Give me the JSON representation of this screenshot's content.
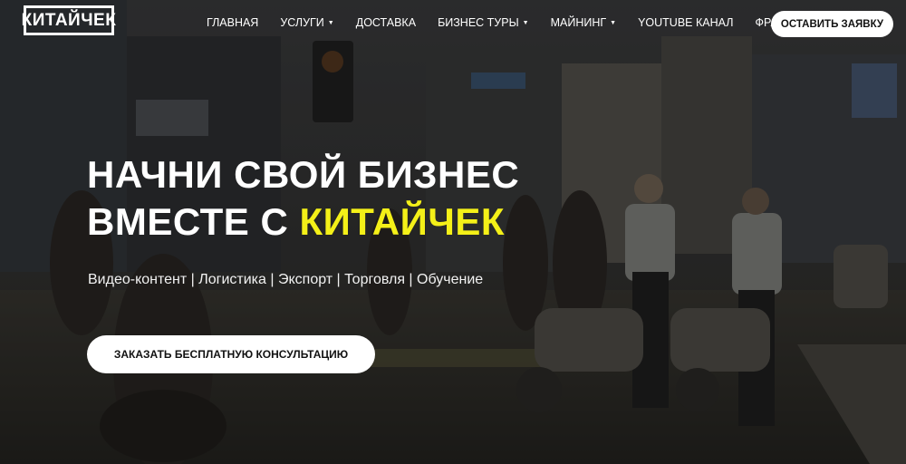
{
  "brand": {
    "logo_text": "КИТАЙЧЕК"
  },
  "nav": {
    "items": [
      {
        "label": "Главная",
        "dropdown": false
      },
      {
        "label": "Услуги",
        "dropdown": true
      },
      {
        "label": "Доставка",
        "dropdown": false
      },
      {
        "label": "Бизнес туры",
        "dropdown": true
      },
      {
        "label": "Майнинг",
        "dropdown": true
      },
      {
        "label": "YouTube канал",
        "dropdown": false
      },
      {
        "label": "Франшизы",
        "dropdown": false
      }
    ],
    "cta_label": "ОСТАВИТЬ ЗАЯВКУ"
  },
  "hero": {
    "title_line1": "НАЧНИ СВОЙ БИЗНЕС",
    "title_line2_prefix": "ВМЕСТЕ С ",
    "title_line2_accent": "КИТАЙЧЕК",
    "subtitle": "Видео-контент | Логистика | Экспорт | Торговля | Обучение",
    "cta_label": "ЗАКАЗАТЬ БЕСПЛАТНУЮ КОНСУЛЬТАЦИЮ"
  },
  "colors": {
    "accent": "#f4f018",
    "button_bg": "#ffffff",
    "button_text": "#111111"
  }
}
